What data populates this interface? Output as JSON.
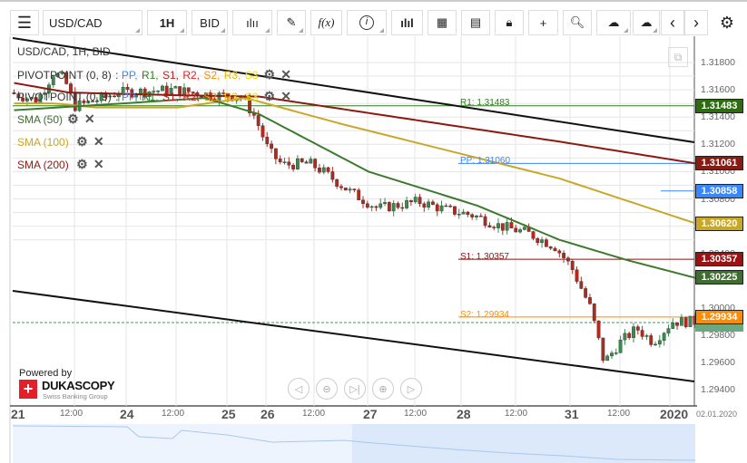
{
  "toolbar": {
    "symbol": "USD/CAD",
    "timeframe": "1H",
    "side": "BID",
    "items": [
      "menu-icon",
      "chart-type-icon",
      "draw-icon",
      "indicator-icon",
      "info-icon",
      "volume-icon",
      "calendar-icon",
      "news-icon",
      "lock-icon",
      "crosshair-icon",
      "zoom-icon",
      "upload-icon",
      "download-icon",
      "prev-icon",
      "next-icon",
      "gear-icon"
    ],
    "fx": "f(x)"
  },
  "legend": {
    "title": "USD/CAD, 1H, BID",
    "pivot1": "PIVOTPOINT (0, 8)",
    "pivot2": "PIVOTPOINT (0, 9)",
    "pv_items": [
      {
        "t": "PP,",
        "c": "#3a86ff"
      },
      {
        "t": "R1,",
        "c": "#2e7d1e"
      },
      {
        "t": "S1,",
        "c": "#b22222"
      },
      {
        "t": "R2,",
        "c": "#e02020"
      },
      {
        "t": "S2,",
        "c": "#ff8c00"
      },
      {
        "t": "R3,",
        "c": "#e8b800"
      },
      {
        "t": "S3",
        "c": "#f0e000"
      }
    ],
    "sma50": "SMA (50)",
    "sma100": "SMA (100)",
    "sma200": "SMA (200)"
  },
  "levels": {
    "r1": "R1: 1.31483",
    "pp": "PP: 1.31060",
    "s1": "S1: 1.30357",
    "s2": "S2: 1.29934"
  },
  "price_labels": [
    {
      "v": "1.31483",
      "p": 1.31483,
      "c": "#2e6b12"
    },
    {
      "v": "1.31061",
      "p": 1.31061,
      "c": "#8b1a10"
    },
    {
      "v": "1.30858",
      "p": 1.30858,
      "c": "#3a86ff"
    },
    {
      "v": "1.30620",
      "p": 1.3062,
      "c": "#c8a82a"
    },
    {
      "v": "1.30357",
      "p": 1.30357,
      "c": "#a01010"
    },
    {
      "v": "1.30225",
      "p": 1.30225,
      "c": "#3d6e2e"
    },
    {
      "v": "1.29934",
      "p": 1.29934,
      "c": "#ff8c00"
    }
  ],
  "price_ticks": [
    "1.31800",
    "1.31600",
    "1.31400",
    "1.31200",
    "1.31000",
    "1.30800",
    "1.30600",
    "1.30400",
    "1.30200",
    "1.30000",
    "1.29800",
    "1.29600",
    "1.29400"
  ],
  "time_labels": [
    {
      "t": "21",
      "b": true
    },
    {
      "t": "12:00"
    },
    {
      "t": "24",
      "b": true
    },
    {
      "t": "12:00"
    },
    {
      "t": "25",
      "b": true
    },
    {
      "t": "26",
      "b": true
    },
    {
      "t": "12:00"
    },
    {
      "t": "27",
      "b": true
    },
    {
      "t": "12:00"
    },
    {
      "t": "28",
      "b": true
    },
    {
      "t": "12:00"
    },
    {
      "t": "31",
      "b": true
    },
    {
      "t": "12:00"
    },
    {
      "t": "2020",
      "b": true
    }
  ],
  "date_end": "02.01.2020",
  "branding": {
    "powered": "Powered by",
    "name": "DUKASCOPY",
    "tagline": "Swiss Banking Group"
  },
  "chart_data": {
    "type": "candlestick",
    "ylim": [
      1.2935,
      1.3205
    ],
    "close_path": [
      [
        0,
        1.3158
      ],
      [
        10,
        1.3152
      ],
      [
        16,
        1.3172
      ],
      [
        20,
        1.3168
      ],
      [
        24,
        1.3148
      ],
      [
        28,
        1.315
      ],
      [
        40,
        1.3158
      ],
      [
        60,
        1.316
      ],
      [
        75,
        1.3156
      ],
      [
        85,
        1.3155
      ],
      [
        90,
        1.314
      ],
      [
        95,
        1.3115
      ],
      [
        100,
        1.3105
      ],
      [
        110,
        1.3106
      ],
      [
        115,
        1.31
      ],
      [
        125,
        1.3085
      ],
      [
        135,
        1.3073
      ],
      [
        150,
        1.3078
      ],
      [
        160,
        1.3072
      ],
      [
        170,
        1.3068
      ],
      [
        180,
        1.306
      ],
      [
        190,
        1.3055
      ],
      [
        200,
        1.3045
      ],
      [
        206,
        1.303
      ],
      [
        213,
        1.3
      ],
      [
        218,
        1.296
      ],
      [
        224,
        1.2975
      ],
      [
        230,
        1.2985
      ],
      [
        236,
        1.2975
      ],
      [
        243,
        1.299
      ],
      [
        250,
        1.299
      ]
    ],
    "sma50": [
      [
        0,
        1.3145
      ],
      [
        40,
        1.315
      ],
      [
        70,
        1.3154
      ],
      [
        90,
        1.3142
      ],
      [
        130,
        1.31
      ],
      [
        170,
        1.3075
      ],
      [
        200,
        1.305
      ],
      [
        225,
        1.3035
      ],
      [
        250,
        1.3022
      ]
    ],
    "sma100": [
      [
        0,
        1.315
      ],
      [
        15,
        1.315
      ],
      [
        30,
        1.3147
      ],
      [
        60,
        1.3147
      ],
      [
        85,
        1.3154
      ],
      [
        120,
        1.3135
      ],
      [
        160,
        1.3115
      ],
      [
        200,
        1.3095
      ],
      [
        250,
        1.3062
      ]
    ],
    "sma200": [
      [
        0,
        1.3165
      ],
      [
        20,
        1.3158
      ],
      [
        60,
        1.3156
      ],
      [
        90,
        1.3155
      ],
      [
        140,
        1.314
      ],
      [
        200,
        1.3122
      ],
      [
        250,
        1.3106
      ]
    ]
  }
}
